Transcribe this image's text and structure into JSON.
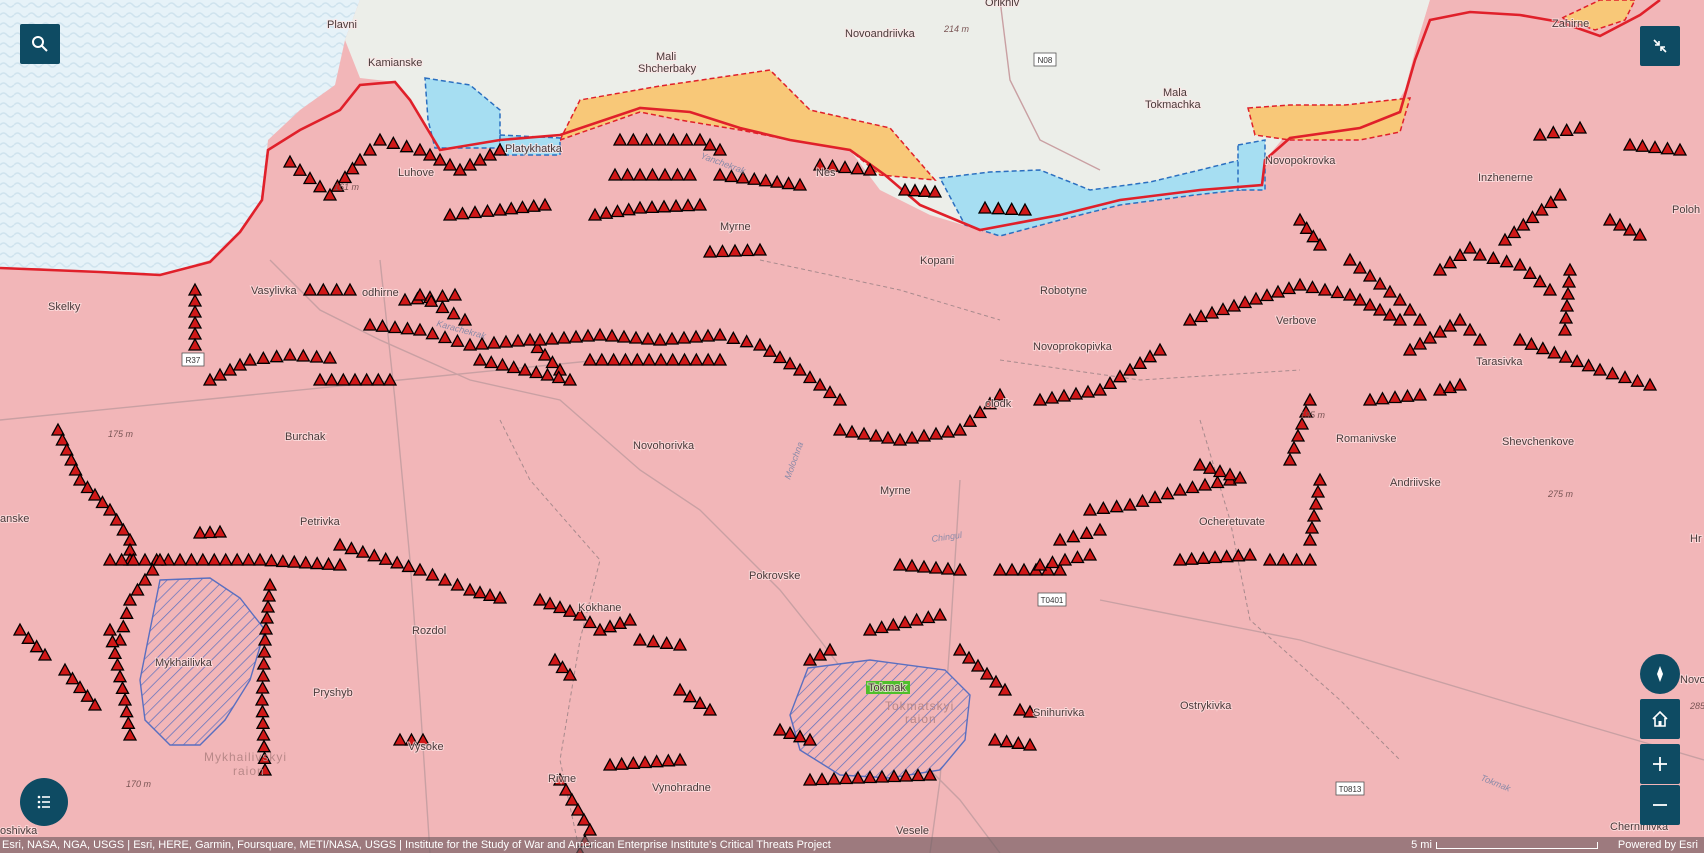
{
  "colors": {
    "occupied": "#f2b6b8",
    "water": "#e8f1f7",
    "land": "#eceee9",
    "gain_yellow": "#f8c878",
    "gain_blue": "#a6def2",
    "front_line": "#e0202a",
    "fortification": "#d01818",
    "controls": "#0e4b63",
    "tokmak_highlight": "#4fbf2c"
  },
  "controls": {
    "search_icon": "search-icon",
    "collapse_icon": "collapse-icon",
    "layers_icon": "list-icon",
    "compass_icon": "compass-icon",
    "home_icon": "home-icon",
    "zoom_in_icon": "plus-icon",
    "zoom_out_icon": "minus-icon"
  },
  "places": {
    "plavni": "Plavni",
    "kamianske": "Kamianske",
    "mali_shcherbaky_1": "Mali",
    "mali_shcherbaky_2": "Shcherbaky",
    "novoandriivka": "Novoandriivka",
    "orikhiv": "Orikhiv",
    "mala_tokmachka_1": "Mala",
    "mala_tokmachka_2": "Tokmachka",
    "zahirne": "Zahirne",
    "novopokrovka": "Novopokrovka",
    "inzhenerne": "Inzhenerne",
    "poloh": "Poloh",
    "luhove": "Luhove",
    "platykhatka": "Platykhatka",
    "nesteriianka": "Nes",
    "myrne_n": "Myrne",
    "kopani": "Kopani",
    "robotyne": "Robotyne",
    "verbove": "Verbove",
    "skelky": "Skelky",
    "vasylivka": "Vasylivka",
    "podhirne": "odhirne",
    "novoprokopivka": "Novoprokopivka",
    "tarasivka": "Tarasivka",
    "solodka": "olodk",
    "burchak": "Burchak",
    "novohorivka": "Novohorivka",
    "romanivske": "Romanivske",
    "shevchenkove": "Shevchenkove",
    "myrne_s": "Myrne",
    "andriivske": "Andriivske",
    "anske": "anske",
    "petrivka": "Petrivka",
    "ocheretuvate": "Ocheretuvate",
    "hr": "Hr",
    "pokrovske": "Pokrovske",
    "kokhane": "Kokhane",
    "rozdol": "Rozdol",
    "mykhailivka": "Mykhailivka",
    "tokmak": "Tokmak",
    "pryshyb": "Pryshyb",
    "snihurivka": "Snihurivka",
    "ostrykivka": "Ostrykivka",
    "novop": "Novop",
    "vysoke": "Vysoke",
    "rivne": "Rivne",
    "vynohradne": "Vynohradne",
    "chernihivka": "Chernihivka",
    "oshivka": "oshivka",
    "vesele": "Vesele",
    "novo_slash": "Novo"
  },
  "raions": {
    "mykhailivskyi_1": "Mykhailivskyi",
    "mykhailivskyi_2": "raion",
    "tokmatskyi_1": "Tokmatskyi",
    "tokmatskyi_2": "raion"
  },
  "elevations": {
    "e214": "214 m",
    "e161": "161 m",
    "e175": "175 m",
    "e195": "195 m",
    "e275": "275 m",
    "e170": "170 m",
    "e285": "285"
  },
  "rivers": {
    "chingul": "Chingul",
    "molochna": "Molochna",
    "tokmak_r": "Tokmak",
    "karachekrak": "Karachekrak",
    "yanchekrak": "Yanchekrak"
  },
  "roads": {
    "n08": "N08",
    "r37": "R37",
    "t0401": "T0401",
    "t0813": "T0813"
  },
  "attribution": {
    "text": "Esri, NASA, NGA, USGS | Esri, HERE, Garmin, Foursquare, METI/NASA, USGS | Institute for the Study of War and American Enterprise Institute's Critical Threats Project",
    "scale": "5 mi",
    "powered": "Powered by Esri"
  }
}
